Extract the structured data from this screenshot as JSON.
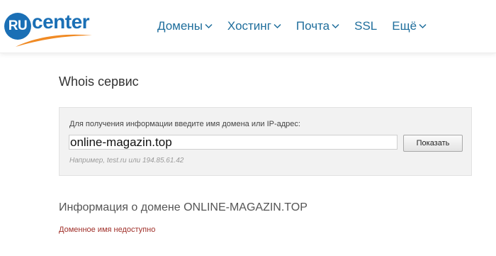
{
  "logo": {
    "badge": "RU",
    "text": "center",
    "brand_color": "#1a6fb5",
    "swoosh_color": "#f08a24"
  },
  "nav": {
    "items": [
      {
        "label": "Домены",
        "dropdown": true
      },
      {
        "label": "Хостинг",
        "dropdown": true
      },
      {
        "label": "Почта",
        "dropdown": true
      },
      {
        "label": "SSL",
        "dropdown": false
      },
      {
        "label": "Ещё",
        "dropdown": true
      }
    ],
    "link_color": "#1f6e9c"
  },
  "main": {
    "title": "Whois сервис",
    "whois": {
      "label": "Для получения информации введите имя домена или IP-адрес:",
      "input_value": "online-magazin.top",
      "button_label": "Показать",
      "example": "Например, test.ru или 194.85.61.42"
    },
    "info_title": "Информация о домене ONLINE-MAGAZIN.TOP",
    "status": "Доменное имя недоступно",
    "status_color": "#a0302a"
  }
}
